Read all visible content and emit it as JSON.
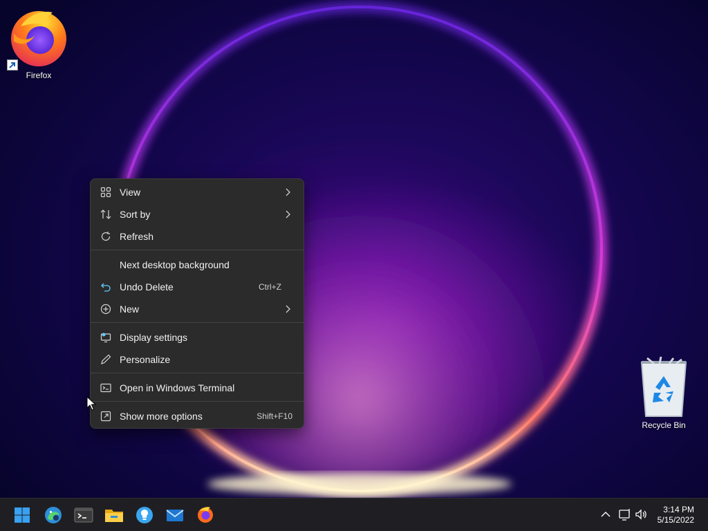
{
  "desktop": {
    "icons": [
      {
        "label": "Firefox",
        "icon": "firefox-icon"
      },
      {
        "label": "Recycle Bin",
        "icon": "recycle-bin-icon"
      }
    ]
  },
  "context_menu": {
    "items": [
      {
        "label": "View",
        "icon": "view-grid-icon",
        "submenu": true
      },
      {
        "label": "Sort by",
        "icon": "sort-icon",
        "submenu": true
      },
      {
        "label": "Refresh",
        "icon": "refresh-icon"
      },
      {
        "label": "Next desktop background"
      },
      {
        "label": "Undo Delete",
        "icon": "undo-icon",
        "shortcut": "Ctrl+Z"
      },
      {
        "label": "New",
        "icon": "new-plus-icon",
        "submenu": true
      },
      {
        "label": "Display settings",
        "icon": "display-settings-icon"
      },
      {
        "label": "Personalize",
        "icon": "personalize-pen-icon"
      },
      {
        "label": "Open in Windows Terminal",
        "icon": "terminal-icon"
      },
      {
        "label": "Show more options",
        "icon": "show-more-options-icon",
        "shortcut": "Shift+F10"
      }
    ]
  },
  "taskbar": {
    "apps": [
      "start-icon",
      "edge-dev-icon",
      "windows-terminal-icon",
      "file-explorer-icon",
      "tips-icon",
      "mail-icon",
      "firefox-icon"
    ],
    "tray": [
      "chevron-up-icon",
      "network-icon",
      "volume-icon"
    ],
    "clock": {
      "time": "3:14 PM",
      "date": "5/15/2022"
    }
  },
  "colors": {
    "menu_background": "#2b2b2b",
    "accent": "#60cdff",
    "taskbar": "#1f1f23"
  }
}
